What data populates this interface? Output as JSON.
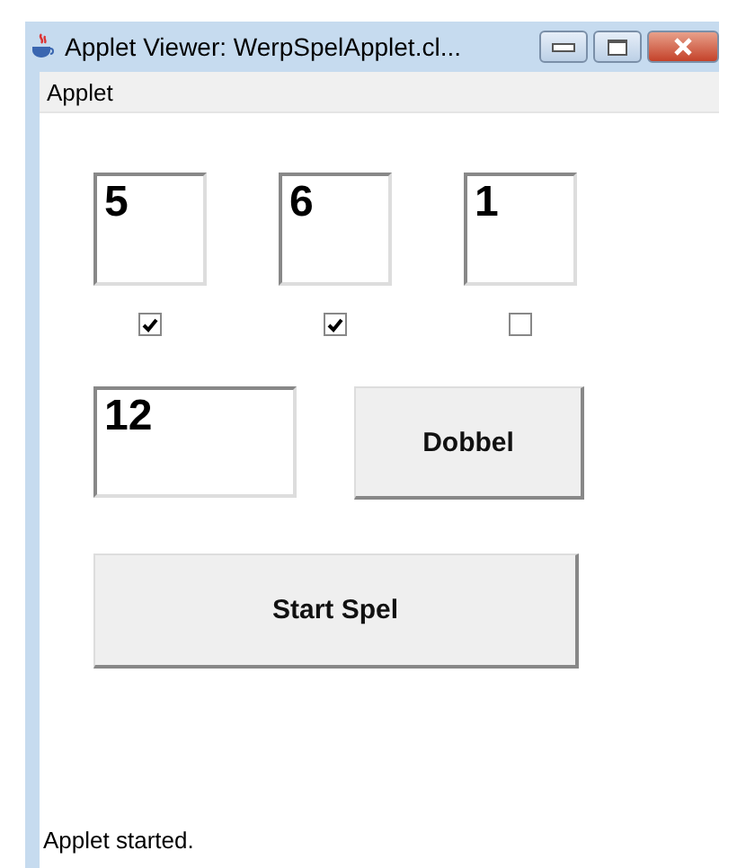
{
  "window": {
    "title": "Applet Viewer: WerpSpelApplet.cl..."
  },
  "menu": [
    "Applet"
  ],
  "dice": [
    {
      "value": "5",
      "checked": true
    },
    {
      "value": "6",
      "checked": true
    },
    {
      "value": "1",
      "checked": false
    }
  ],
  "total": {
    "value": "12"
  },
  "buttons": [
    "Dobbel",
    "Start Spel"
  ],
  "status_bar": "Applet started."
}
